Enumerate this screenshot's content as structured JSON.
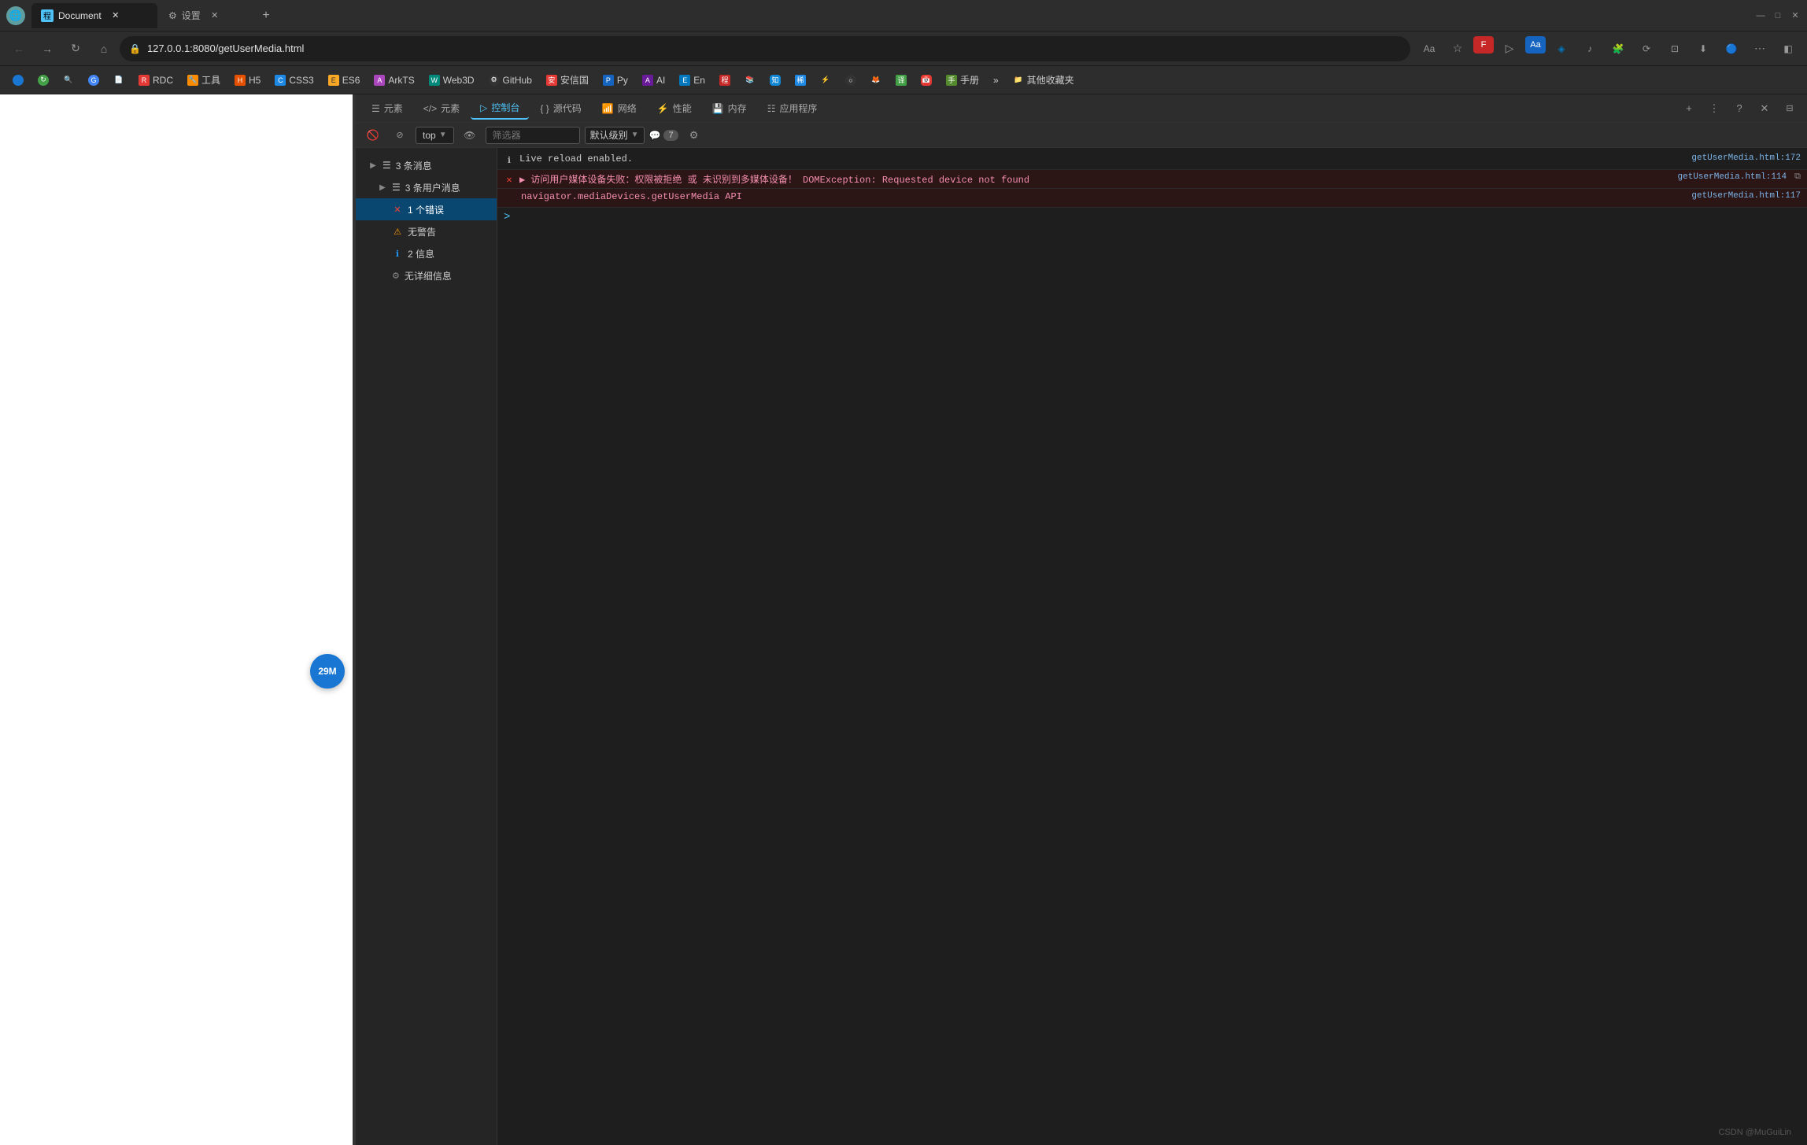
{
  "window": {
    "title": "Document",
    "min": "—",
    "max": "□",
    "close": "✕"
  },
  "tabs": [
    {
      "id": "tab1",
      "label": "Document",
      "icon": "程",
      "active": true
    },
    {
      "id": "tab2",
      "label": "设置",
      "icon": "⚙",
      "active": false
    }
  ],
  "address": "127.0.0.1:8080/getUserMedia.html",
  "nav": {
    "back": "←",
    "forward": "→",
    "reload": "↻",
    "home": "⌂"
  },
  "bookmarks": [
    {
      "label": "RDC",
      "color": "#e53935"
    },
    {
      "label": "工具",
      "color": "#fb8c00"
    },
    {
      "label": "H5",
      "color": "#43a047"
    },
    {
      "label": "CSS3",
      "color": "#1e88e5"
    },
    {
      "label": "ES6",
      "color": "#f9a825"
    },
    {
      "label": "ArkTS",
      "color": "#ab47bc"
    },
    {
      "label": "Web3D",
      "color": "#00897b"
    },
    {
      "label": "GitHub",
      "color": "#333"
    },
    {
      "label": "安信国",
      "color": "#e53935"
    },
    {
      "label": "Py",
      "color": "#1565c0"
    },
    {
      "label": "AI",
      "color": "#6a1b9a"
    },
    {
      "label": "En",
      "color": "#0277bd"
    },
    {
      "label": "程",
      "color": "#c62828"
    },
    {
      "label": "手册",
      "color": "#558b2f"
    },
    {
      "label": "其他收藏夹",
      "color": "#555"
    }
  ],
  "page": {
    "badge": "29M"
  },
  "devtools": {
    "tabs": [
      {
        "id": "elements",
        "icon": "☰",
        "label": "元素"
      },
      {
        "id": "console",
        "icon": "▷",
        "label": "控制台",
        "active": true
      },
      {
        "id": "sources",
        "icon": "{ }",
        "label": "源代码"
      },
      {
        "id": "network",
        "icon": "📶",
        "label": "网络"
      },
      {
        "id": "performance",
        "icon": "⚡",
        "label": "性能"
      },
      {
        "id": "memory",
        "icon": "💾",
        "label": "内存"
      },
      {
        "id": "application",
        "icon": "☷",
        "label": "应用程序"
      }
    ],
    "toolbar_end": {
      "add": "+",
      "more": "⋮",
      "help": "?",
      "close": "✕"
    }
  },
  "console": {
    "context": "top",
    "filter_placeholder": "筛选器",
    "level": "默认级别",
    "message_count": "7",
    "sidebar_items": [
      {
        "id": "all_messages",
        "label": "3 条消息",
        "count": ""
      },
      {
        "id": "user_messages",
        "label": "3 条用户消息",
        "count": ""
      },
      {
        "id": "errors",
        "label": "1 个错误",
        "count": "1",
        "type": "error"
      },
      {
        "id": "warnings",
        "label": "无警告",
        "count": "",
        "type": "warning"
      },
      {
        "id": "info",
        "label": "2 信息",
        "count": "2",
        "type": "info"
      },
      {
        "id": "verbose",
        "label": "无详细信息",
        "count": "",
        "type": "verbose"
      }
    ],
    "messages": [
      {
        "type": "info",
        "content": "Live reload enabled.",
        "link": "getUserMedia.html:172"
      },
      {
        "type": "error",
        "content": "▶ 访问用户媒体设备失败：权限被拒绝 或 未识别到多媒体设备！ DOMException: Requested device not found",
        "link": "getUserMedia.html:114"
      },
      {
        "type": "error_detail",
        "content": "navigator.mediaDevices.getUserMedia API",
        "link": "getUserMedia.html:117"
      }
    ],
    "prompt_arrow": ">"
  },
  "watermark": "CSDN @MuGuiLin"
}
